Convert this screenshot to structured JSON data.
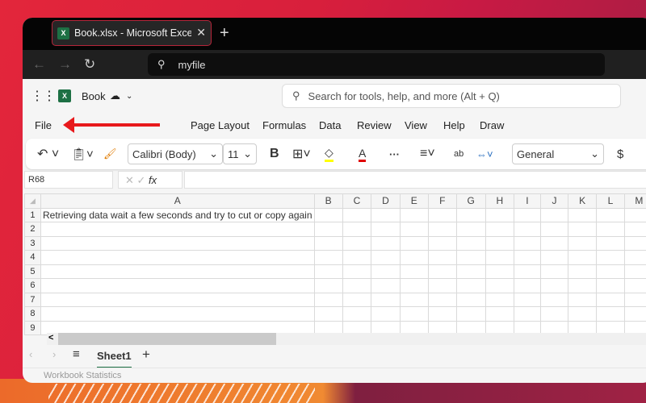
{
  "browser": {
    "tab_title": "Book.xlsx - Microsoft Excel Online",
    "address": "myfile"
  },
  "app": {
    "file_name": "Book",
    "search_placeholder": "Search for tools, help, and more (Alt + Q)"
  },
  "menu": {
    "file": "File",
    "items": [
      "Page Layout",
      "Formulas",
      "Data",
      "Review",
      "View",
      "Help",
      "Draw"
    ]
  },
  "toolbar": {
    "font": "Calibri (Body)",
    "font_size": "11",
    "bold": "B",
    "number_format": "General",
    "currency": "$",
    "more": "···",
    "fill_color": "#ffff00",
    "font_color": "#e00000"
  },
  "formula_bar": {
    "name_box": "R68",
    "fx": "fx",
    "value": ""
  },
  "grid": {
    "columns": [
      "A",
      "B",
      "C",
      "D",
      "E",
      "F",
      "G",
      "H",
      "I",
      "J",
      "K",
      "L",
      "M"
    ],
    "rows": [
      "1",
      "2",
      "3",
      "4",
      "5",
      "6",
      "7",
      "8",
      "9"
    ],
    "cells": {
      "A1": "Retrieving data wait a few seconds and try to cut or copy again"
    }
  },
  "sheets": {
    "tabs": [
      "Sheet1"
    ],
    "active": "Sheet1",
    "accent": "#1e7145"
  },
  "status": {
    "text": "Workbook Statistics"
  },
  "annotation_arrow_color": "#e8191c"
}
